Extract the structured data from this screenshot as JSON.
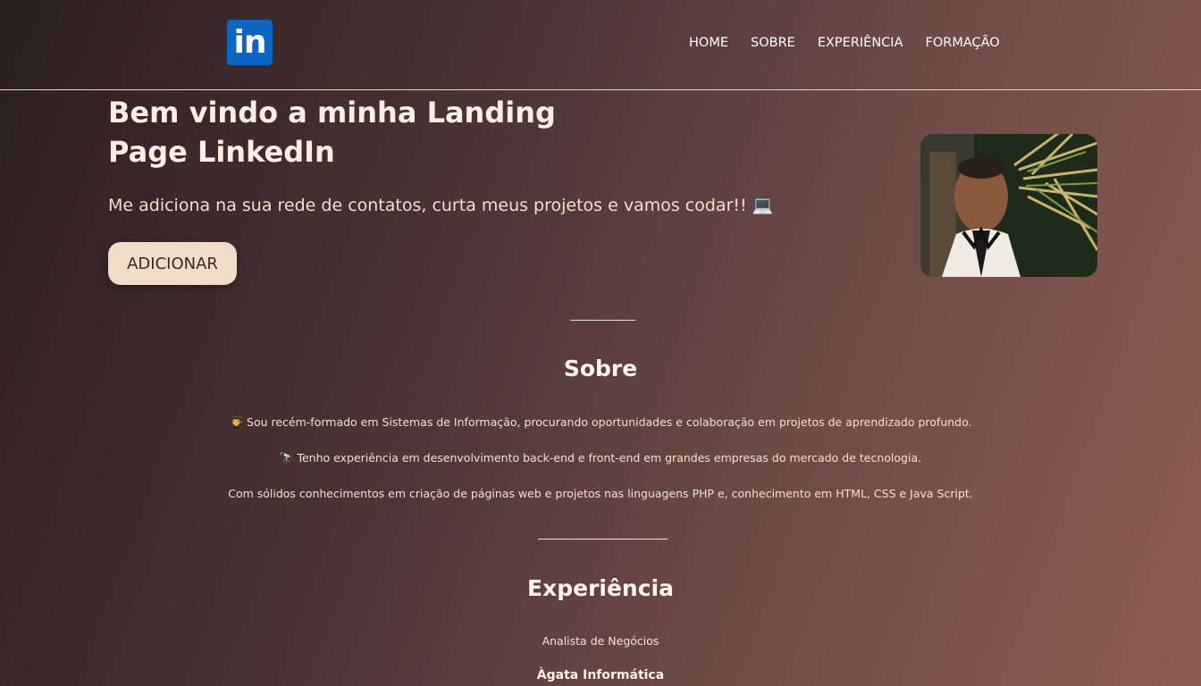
{
  "header": {
    "logo_text": "in",
    "nav": [
      "HOME",
      "SOBRE",
      "EXPERIÊNCIA",
      "FORMAÇÃO"
    ]
  },
  "hero": {
    "title": "Bem vindo a minha Landing Page LinkedIn",
    "subtitle": "Me adiciona na sua rede de contatos, curta meus projetos e vamos codar!! 💻",
    "button": "ADICIONAR"
  },
  "about": {
    "title": "Sobre",
    "paragraphs": [
      "👨‍🎓 Sou recém-formado em Sistemas de Informação, procurando oportunidades e colaboração em projetos de aprendizado profundo.",
      "🔭 Tenho experiência em desenvolvimento back-end e front-end em grandes empresas do mercado de tecnologia.",
      "Com sólidos conhecimentos em criação de páginas web e projetos nas linguagens PHP e, conhecimento em HTML, CSS e Java Script."
    ]
  },
  "experience": {
    "title": "Experiência",
    "role": "Analista de Negócios",
    "company": "Àgata Informática"
  },
  "colors": {
    "linkedin_blue": "#0a66c2",
    "button_bg": "#f1dcc8",
    "gradient_start": "#2b1f21",
    "gradient_end": "#8d5d52"
  }
}
